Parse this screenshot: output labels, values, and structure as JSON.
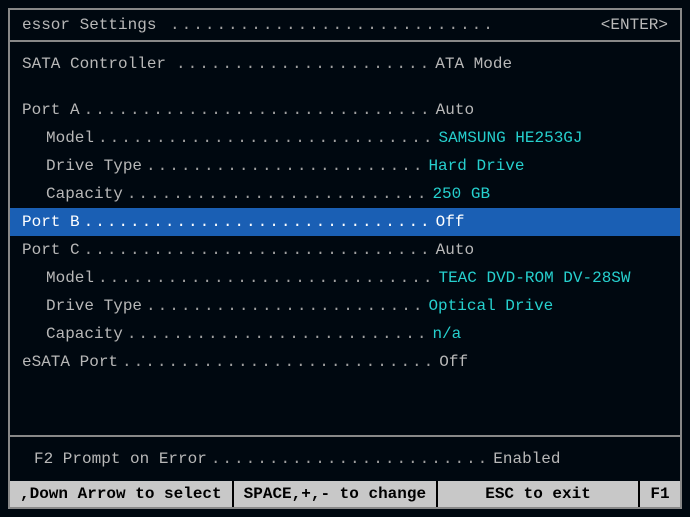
{
  "header": {
    "title": "essor Settings",
    "dots": "............................",
    "action": "<ENTER>"
  },
  "sata": {
    "label": "SATA Controller",
    "dots": "......................",
    "value": "ATA Mode"
  },
  "ports": [
    {
      "label": "Port A",
      "dots": "..............................",
      "value": "Auto",
      "highlighted": false,
      "interactable": true,
      "children": [
        {
          "label": "Model",
          "dots": ".............................",
          "value": "SAMSUNG HE253GJ",
          "cyan": true
        },
        {
          "label": "Drive Type",
          "dots": "........................",
          "value": "Hard Drive",
          "cyan": true
        },
        {
          "label": "Capacity",
          "dots": "..........................",
          "value": "250 GB",
          "cyan": true
        }
      ]
    },
    {
      "label": "Port B",
      "dots": "..............................",
      "value": "Off",
      "highlighted": true,
      "interactable": true,
      "children": []
    },
    {
      "label": "Port C",
      "dots": "..............................",
      "value": "Auto",
      "highlighted": false,
      "interactable": true,
      "children": [
        {
          "label": "Model",
          "dots": ".............................",
          "value": "TEAC DVD-ROM DV-28SW",
          "cyan": true
        },
        {
          "label": "Drive Type",
          "dots": "........................",
          "value": "Optical Drive",
          "cyan": true
        },
        {
          "label": "Capacity",
          "dots": "..........................",
          "value": "n/a",
          "cyan": true
        }
      ]
    },
    {
      "label": "eSATA Port",
      "dots": "...........................",
      "value": "Off",
      "highlighted": false,
      "interactable": true,
      "children": []
    }
  ],
  "footer": {
    "label": "F2 Prompt on Error",
    "dots": "........................",
    "value": "Enabled"
  },
  "helpbar": {
    "select": ",Down Arrow to select",
    "change": "SPACE,+,- to change",
    "exit": "ESC to exit",
    "f1": "F1"
  }
}
